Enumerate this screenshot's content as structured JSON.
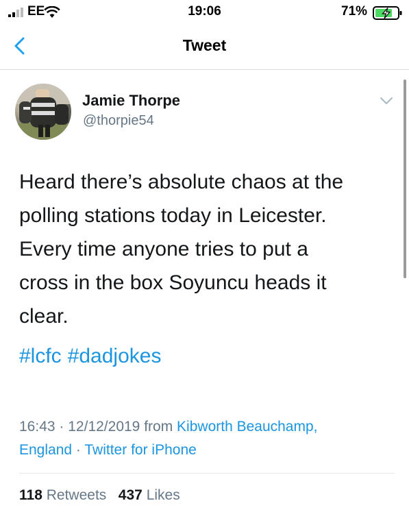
{
  "status_bar": {
    "carrier": "EE",
    "time": "19:06",
    "battery_percent": "71%",
    "icons": [
      "signal-icon",
      "wifi-icon",
      "battery-charging-icon"
    ]
  },
  "nav": {
    "title": "Tweet",
    "back_icon": "chevron-left-icon"
  },
  "tweet": {
    "author_name": "Jamie Thorpe",
    "author_handle": "@thorpie54",
    "text_lines": [
      "Heard there’s absolute chaos at the",
      "polling stations today in Leicester.",
      "Every time anyone tries to put a",
      "cross in the box Soyuncu heads it",
      "clear."
    ],
    "hashtags": [
      "#lcfc",
      "#dadjokes"
    ],
    "time": "16:43",
    "date": "12/12/2019",
    "from_label": "from",
    "location_line1": "Kibworth Beauchamp,",
    "location_line2": "England",
    "separator": "·",
    "client": "Twitter for iPhone",
    "retweets_count": "118",
    "retweets_label": "Retweets",
    "likes_count": "437",
    "likes_label": "Likes"
  },
  "colors": {
    "link": "#1b95e0",
    "secondary_text": "#657786",
    "primary_text": "#14171a",
    "nav_back": "#1da1f2"
  }
}
